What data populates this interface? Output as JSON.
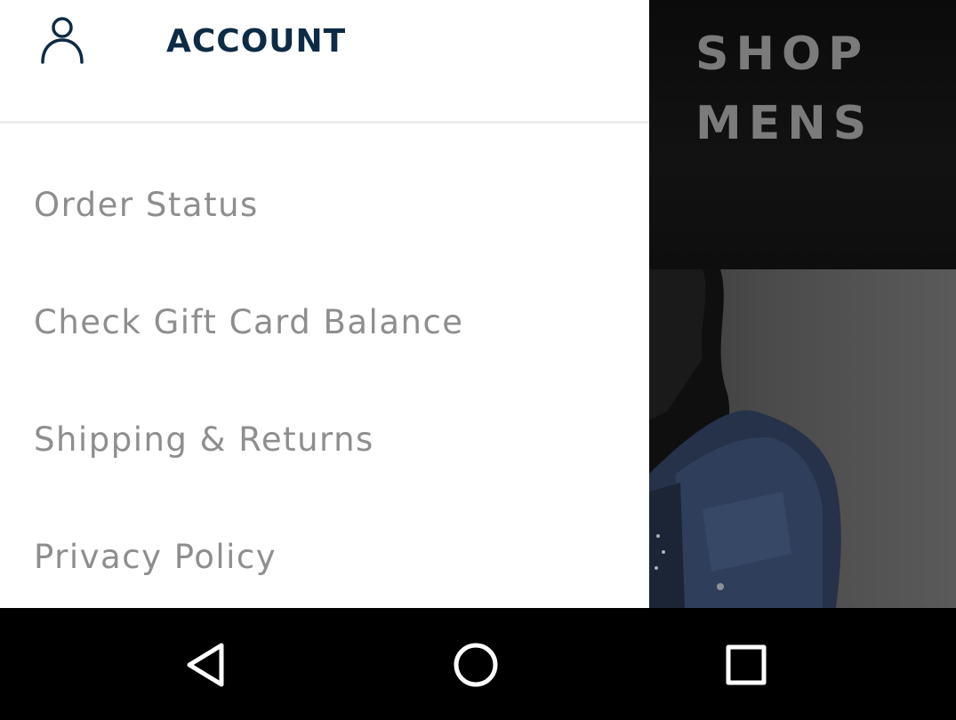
{
  "promo": {
    "line1": "SHOP",
    "line2": "MENS"
  },
  "drawer": {
    "header": {
      "icon": "user-icon",
      "title": "ACCOUNT"
    },
    "items": [
      {
        "label": "Order Status"
      },
      {
        "label": "Check Gift Card Balance"
      },
      {
        "label": "Shipping & Returns"
      },
      {
        "label": "Privacy Policy"
      }
    ]
  },
  "navbar": {
    "icons": [
      "back-icon",
      "home-icon",
      "recent-apps-icon"
    ]
  },
  "colors": {
    "accent": "#0d2b45",
    "menu_text": "#8e8e8e",
    "divider": "#ececec"
  }
}
